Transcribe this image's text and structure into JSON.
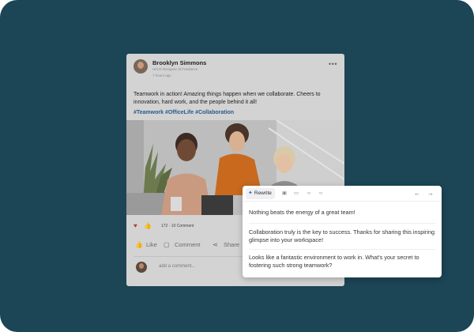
{
  "post": {
    "author": "Brooklyn Simmons",
    "role": "Ui/UX Designer at Freelance",
    "time": "7 hours ago",
    "text": "Teamwork in action! Amazing things happen when we collaborate. Cheers to innovation, hard work, and the people behind it all!",
    "hashtags": "#Teamwork #OfficeLife #Collaboration",
    "reaction_count": "172 · 10 Comment",
    "actions": {
      "like": "Like",
      "comment": "Comment",
      "share": "Share"
    },
    "comment_placeholder": "add a comment..."
  },
  "panel": {
    "rewrite_label": "Rewrite",
    "suggestions": [
      "Nothing beats the energy of a great team!",
      "Collaboration truly is the key to success. Thanks for sharing this inspiring glimpse into your workspace!",
      "Looks like a fantastic environment to work in. What's your secret to fostering such strong teamwork?"
    ]
  },
  "colors": {
    "background": "#1c4555",
    "hashtag": "#2b5a86",
    "accent": "#3a63c8"
  }
}
